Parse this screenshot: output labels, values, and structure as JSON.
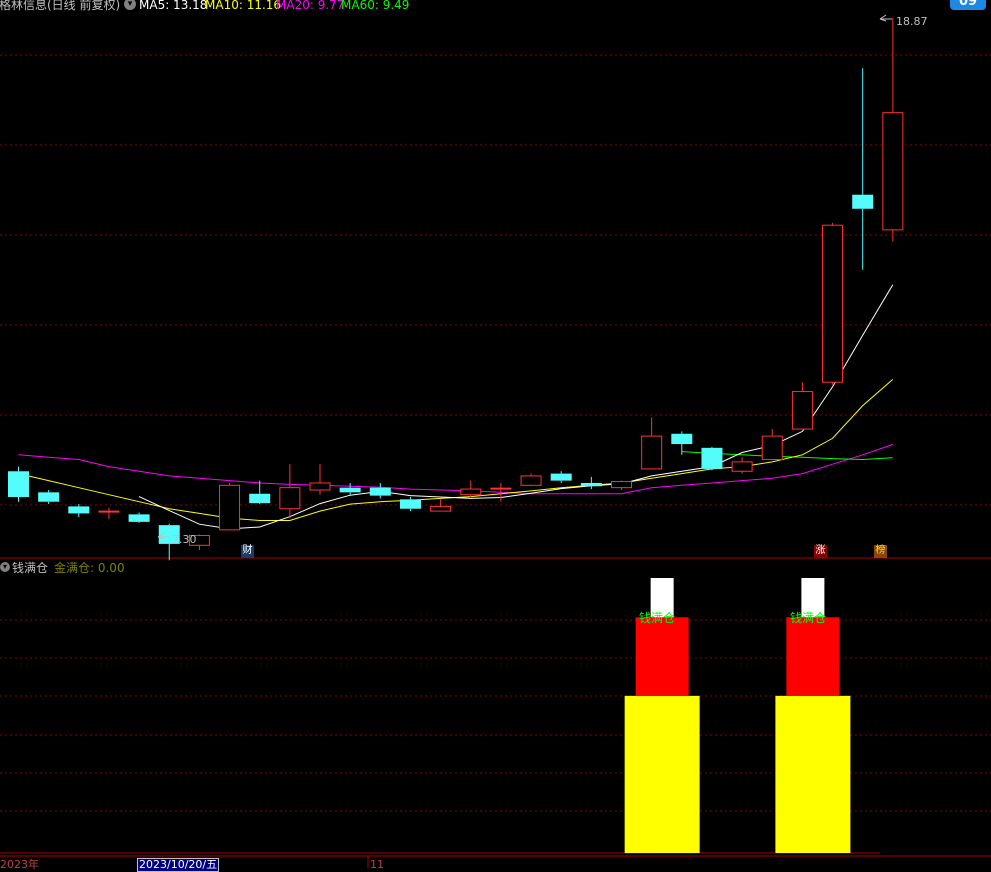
{
  "header": {
    "stock": "格林信息(日线 前复权)",
    "ma": [
      {
        "label": "MA5: 13.18",
        "color": "#ffffff"
      },
      {
        "label": "MA10: 11.16",
        "color": "#ffff00"
      },
      {
        "label": "MA20: 9.77",
        "color": "#ff00ff"
      },
      {
        "label": "MA60: 9.49",
        "color": "#00ff00"
      }
    ],
    "badge": "09"
  },
  "indicator": {
    "name": "钱满仓",
    "value_label": "金满仓: 0.00",
    "signal_label": "钱满仓"
  },
  "markers": {
    "cai": "财",
    "zhang": "涨",
    "bang": "榜"
  },
  "annotations": {
    "high": "18.87",
    "low": "7.30"
  },
  "timeline": {
    "year": "2023年",
    "date": "2023/10/20/五",
    "month": "11"
  },
  "colors": {
    "up": "#ff3232",
    "down": "#54fcfc",
    "ma5": "#ffffff",
    "ma10": "#ffff00",
    "ma20": "#ff00ff",
    "ma60": "#00ff00",
    "grid": "#8b0000"
  },
  "chart_data": {
    "type": "candlestick",
    "ylim": [
      7.0,
      19.2
    ],
    "candles": [
      {
        "o": 9.2,
        "h": 9.3,
        "l": 8.55,
        "c": 8.65
      },
      {
        "o": 8.75,
        "h": 8.8,
        "l": 8.5,
        "c": 8.55
      },
      {
        "o": 8.45,
        "h": 8.5,
        "l": 8.22,
        "c": 8.3
      },
      {
        "o": 8.33,
        "h": 8.42,
        "l": 8.18,
        "c": 8.35
      },
      {
        "o": 8.28,
        "h": 8.32,
        "l": 8.1,
        "c": 8.12
      },
      {
        "o": 8.05,
        "h": 8.08,
        "l": 7.3,
        "c": 7.65
      },
      {
        "o": 7.62,
        "h": 7.85,
        "l": 7.52,
        "c": 7.83
      },
      {
        "o": 7.95,
        "h": 8.95,
        "l": 7.95,
        "c": 8.9
      },
      {
        "o": 8.72,
        "h": 9.0,
        "l": 8.5,
        "c": 8.52
      },
      {
        "o": 8.4,
        "h": 9.35,
        "l": 8.2,
        "c": 8.85
      },
      {
        "o": 8.8,
        "h": 9.35,
        "l": 8.7,
        "c": 8.95
      },
      {
        "o": 8.85,
        "h": 8.95,
        "l": 8.7,
        "c": 8.75
      },
      {
        "o": 8.85,
        "h": 8.95,
        "l": 8.62,
        "c": 8.68
      },
      {
        "o": 8.6,
        "h": 8.65,
        "l": 8.35,
        "c": 8.4
      },
      {
        "o": 8.35,
        "h": 8.6,
        "l": 8.35,
        "c": 8.45
      },
      {
        "o": 8.7,
        "h": 9.0,
        "l": 8.65,
        "c": 8.82
      },
      {
        "o": 8.82,
        "h": 8.95,
        "l": 8.55,
        "c": 8.84
      },
      {
        "o": 8.9,
        "h": 9.15,
        "l": 8.9,
        "c": 9.1
      },
      {
        "o": 9.15,
        "h": 9.2,
        "l": 8.95,
        "c": 9.0
      },
      {
        "o": 8.95,
        "h": 9.08,
        "l": 8.82,
        "c": 8.88
      },
      {
        "o": 8.85,
        "h": 9.0,
        "l": 8.8,
        "c": 8.98
      },
      {
        "o": 9.25,
        "h": 10.35,
        "l": 9.25,
        "c": 9.95
      },
      {
        "o": 10.0,
        "h": 10.05,
        "l": 9.55,
        "c": 9.78
      },
      {
        "o": 9.7,
        "h": 9.72,
        "l": 9.22,
        "c": 9.25
      },
      {
        "o": 9.2,
        "h": 9.5,
        "l": 9.15,
        "c": 9.4
      },
      {
        "o": 9.45,
        "h": 10.1,
        "l": 9.45,
        "c": 9.95
      },
      {
        "o": 10.1,
        "h": 11.1,
        "l": 10.1,
        "c": 10.9
      },
      {
        "o": 11.1,
        "h": 14.5,
        "l": 11.05,
        "c": 14.45
      },
      {
        "o": 15.1,
        "h": 17.8,
        "l": 13.5,
        "c": 14.8
      },
      {
        "o": 14.35,
        "h": 18.87,
        "l": 14.1,
        "c": 16.85
      }
    ],
    "ma5": [
      null,
      null,
      null,
      null,
      8.66,
      8.36,
      8.07,
      7.97,
      8.01,
      8.23,
      8.51,
      8.69,
      8.77,
      8.68,
      8.65,
      8.62,
      8.64,
      8.73,
      8.83,
      8.89,
      8.93,
      9.1,
      9.2,
      9.3,
      9.6,
      9.75,
      10.05,
      11.0,
      12.1,
      13.18
    ],
    "ma10": [
      9.15,
      9.0,
      8.85,
      8.7,
      8.55,
      8.4,
      8.3,
      8.2,
      8.15,
      8.15,
      8.35,
      8.5,
      8.55,
      8.58,
      8.62,
      8.66,
      8.72,
      8.78,
      8.85,
      8.9,
      8.95,
      9.05,
      9.15,
      9.25,
      9.3,
      9.4,
      9.55,
      9.9,
      10.6,
      11.16
    ],
    "ma20": [
      9.55,
      9.5,
      9.45,
      9.3,
      9.2,
      9.1,
      9.05,
      9.0,
      8.95,
      8.92,
      8.9,
      8.88,
      8.86,
      8.82,
      8.8,
      8.78,
      8.75,
      8.72,
      8.72,
      8.72,
      8.72,
      8.85,
      8.9,
      8.95,
      9.0,
      9.05,
      9.15,
      9.35,
      9.55,
      9.77
    ],
    "ma60": [
      null,
      null,
      null,
      null,
      null,
      null,
      null,
      null,
      null,
      null,
      null,
      null,
      null,
      null,
      null,
      null,
      null,
      null,
      null,
      null,
      null,
      null,
      9.62,
      9.58,
      9.55,
      9.52,
      9.5,
      9.47,
      9.45,
      9.49
    ],
    "signals": [
      {
        "index": 21,
        "levels": [
          20,
          30,
          35
        ]
      },
      {
        "index": 26,
        "levels": [
          20,
          30,
          35
        ]
      }
    ],
    "indicator_ylim": [
      0,
      35
    ]
  }
}
